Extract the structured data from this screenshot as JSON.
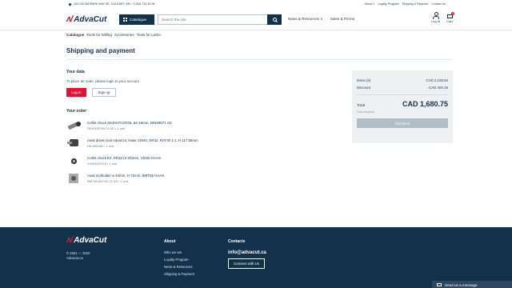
{
  "topbar": {
    "address": "100-240 MIDPARK WAY SE, CALGARY, AB  •  +1 825 734 44 98",
    "links": [
      "About ∨",
      "Loyalty Program",
      "Shipping & Payment",
      "Contact Us"
    ]
  },
  "header": {
    "logo": "AdvaCut",
    "catalogue": "Catalogue",
    "search_placeholder": "Search the site",
    "nav": [
      "News & Resources ∨",
      "Sales & Promo"
    ],
    "login": "Log In",
    "cart": "Cart",
    "cart_count": "4"
  },
  "breadcrumbs": [
    "Catalogue",
    "Tools for Milling",
    "Accessories",
    "Tools for Lathe"
  ],
  "page_title": "Shipping and payment",
  "your_data": {
    "heading": "Your data",
    "note": "To place an order, please login to your account",
    "login_btn": "Log In",
    "signup_btn": "Sign up"
  },
  "order": {
    "heading": "Your order",
    "items": [
      {
        "name": "Collet chuck SK40x70 ER25, ø2-16mm, DIN69871 AD",
        "sku": "SK40ER25H70.AD",
        "qty": "1 unit"
      },
      {
        "name": "Axial driven tool AdvaCut, Haas VDI40, ER32, RAT30 1:1, H 117.55mm",
        "sku": "HA.590083",
        "qty": "1 unit"
      },
      {
        "name": "Collet chuck E4, ER32 (2-20)mm, VDI40 HAAS",
        "sku": "V40E632H78",
        "qty": "1 unit"
      },
      {
        "name": "Axial toolholder ø 40mm, H 72mm, BMT65 HAAS",
        "sku": "BMT65.B0T40.72.DS",
        "qty": "1 unit"
      }
    ]
  },
  "summary": {
    "items_label": "Items (4)",
    "items_value": "CAD 2,100.94",
    "discount_label": "Discount",
    "discount_value": "-CAD 420.19",
    "total_label": "Total",
    "total_value": "CAD 1,680.75",
    "shipping_note": "Free shipping",
    "checkout": "Checkout"
  },
  "footer": {
    "logo": "AdvaCut",
    "copyright": "© 2021 — 2023",
    "domain": "Advacut.ca",
    "about_heading": "About",
    "about_links": [
      "Who we are",
      "Loyalty Program",
      "News & Resources",
      "Shipping & Payment"
    ],
    "contacts_heading": "Contacts",
    "email": "info@advacut.ca",
    "connect": "Connect with Us"
  },
  "chat": "Send us a message",
  "colors": {
    "brand_navy": "#12324c",
    "accent_red": "#e3132f",
    "panel_bg": "#eef1f3"
  }
}
